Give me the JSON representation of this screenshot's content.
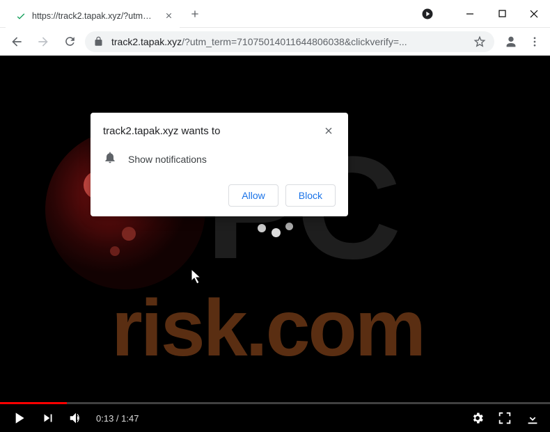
{
  "window": {
    "tab_title": "https://track2.tapak.xyz/?utm_ter"
  },
  "toolbar": {
    "url_host": "track2.tapak.xyz",
    "url_path": "/?utm_term=71075014011644806038&clickverify=..."
  },
  "permission": {
    "title": "track2.tapak.xyz wants to",
    "notification_label": "Show notifications",
    "allow_label": "Allow",
    "block_label": "Block"
  },
  "video": {
    "current": "0:13",
    "duration": "1:47",
    "progress_pct": 12.2
  },
  "watermark": {
    "line1": "PC",
    "line2": "risk.com"
  }
}
